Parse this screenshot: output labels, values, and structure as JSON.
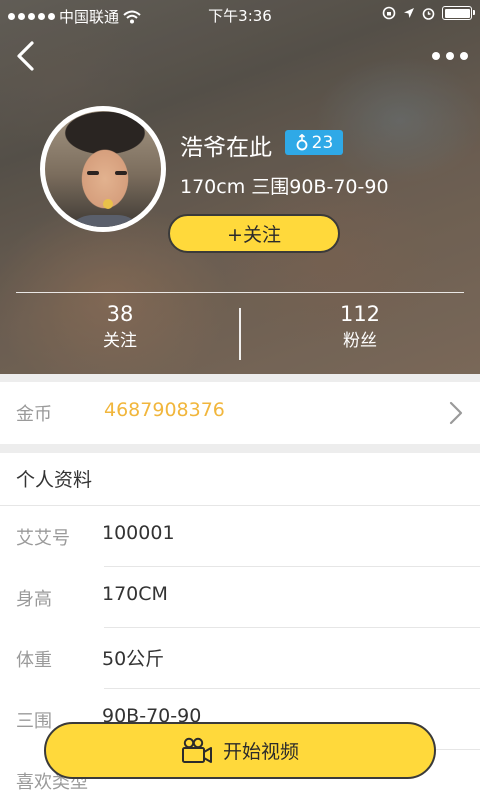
{
  "status_bar": {
    "carrier": "中国联通",
    "time": "下午3:36"
  },
  "profile": {
    "name": "浩爷在此",
    "age": "23",
    "stats": "170cm 三围90B-70-90",
    "follow_label": "+关注",
    "following_count": "38",
    "following_label": "关注",
    "fans_count": "112",
    "fans_label": "粉丝"
  },
  "coins": {
    "label": "金币",
    "value": "4687908376"
  },
  "details": {
    "title": "个人资料",
    "rows": [
      {
        "label": "艾艾号",
        "value": "100001"
      },
      {
        "label": "身高",
        "value": "170CM"
      },
      {
        "label": "体重",
        "value": "50公斤"
      },
      {
        "label": "三围",
        "value": "90B-70-90"
      },
      {
        "label": "喜欢类型",
        "value": ""
      }
    ]
  },
  "actions": {
    "video_label": "开始视频"
  },
  "colors": {
    "accent_yellow": "#ffd93b",
    "coin_orange": "#f1b63c",
    "badge_blue": "#2fa9e7"
  },
  "icons": {
    "back": "chevron-left-icon",
    "more": "more-dots-icon",
    "gender": "male-icon",
    "row_arrow": "chevron-right-icon",
    "video": "video-camera-icon"
  }
}
